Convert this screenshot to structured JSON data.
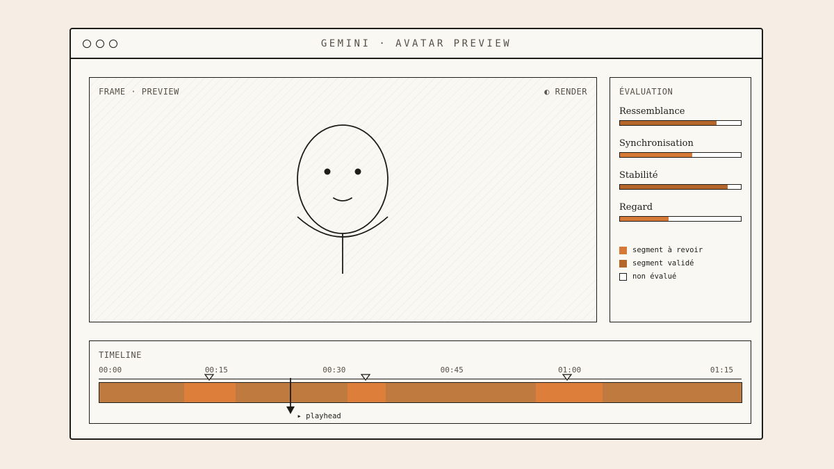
{
  "window": {
    "title": "GEMINI · AVATAR PREVIEW"
  },
  "preview": {
    "label": "FRAME · PREVIEW",
    "render_icon": "half-circle-icon",
    "render_label": "◐ RENDER"
  },
  "evaluation": {
    "title": "ÉVALUATION",
    "metrics": [
      {
        "label": "Ressemblance",
        "value": 0.8,
        "color": "#b3652a"
      },
      {
        "label": "Synchronisation",
        "value": 0.6,
        "color": "#d77936"
      },
      {
        "label": "Stabilité",
        "value": 0.89,
        "color": "#b3652a"
      },
      {
        "label": "Regard",
        "value": 0.4,
        "color": "#d77936"
      }
    ],
    "legend": [
      {
        "label": "segment à revoir",
        "color": "#d77936"
      },
      {
        "label": "segment validé",
        "color": "#b3652a"
      },
      {
        "label": "non évalué",
        "color": "#ffffff"
      }
    ]
  },
  "timeline": {
    "title": "TIMELINE",
    "duration_seconds": 82,
    "ticks": [
      {
        "label": "00:00",
        "seconds": 0
      },
      {
        "label": "00:15",
        "seconds": 15
      },
      {
        "label": "00:30",
        "seconds": 30
      },
      {
        "label": "00:45",
        "seconds": 45
      },
      {
        "label": "01:00",
        "seconds": 60
      },
      {
        "label": "01:15",
        "seconds": 75
      }
    ],
    "review_segments": [
      {
        "start": 10.8,
        "end": 17.4
      },
      {
        "start": 31.6,
        "end": 36.5
      },
      {
        "start": 55.6,
        "end": 64.1
      }
    ],
    "markers_seconds": [
      14.1,
      34.0,
      59.7
    ],
    "playhead_seconds": 24.4,
    "playhead_label": "▸ playhead",
    "colors": {
      "track": "#bf7a40",
      "review": "#dd7e3a"
    }
  }
}
